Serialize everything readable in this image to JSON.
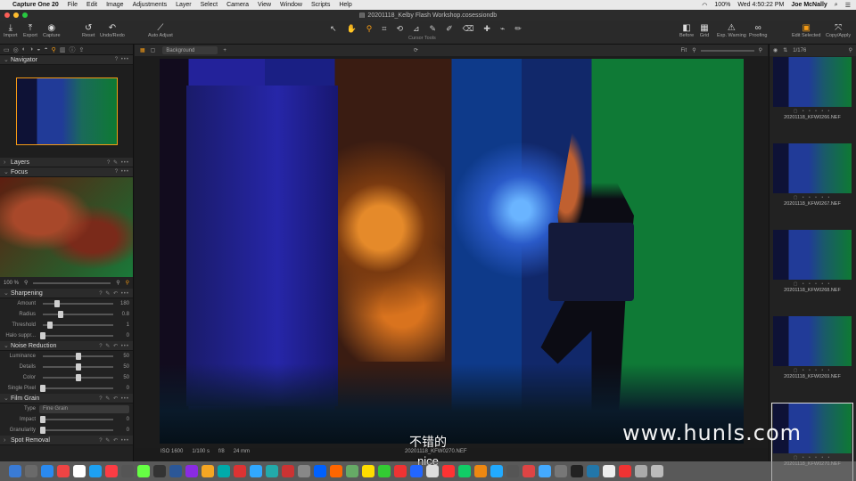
{
  "menubar": {
    "app": "Capture One 20",
    "items": [
      "File",
      "Edit",
      "Image",
      "Adjustments",
      "Layer",
      "Select",
      "Camera",
      "View",
      "Window",
      "Scripts",
      "Help"
    ],
    "battery": "100%",
    "clock": "Wed 4:50:22 PM",
    "user": "Joe McNally"
  },
  "window": {
    "title": "20201118_Kelby Flash Workshop.cosessiondb"
  },
  "toolbar": {
    "import": "Import",
    "export": "Export",
    "capture": "Capture",
    "reset": "Reset",
    "undo_redo": "Undo/Redo",
    "auto_adjust": "Auto Adjust",
    "cursor_tools": "Cursor Tools",
    "before": "Before",
    "grid": "Grid",
    "exp_warning": "Exp. Warning",
    "proofing": "Proofing",
    "edit_selected": "Edit Selected",
    "copy_apply": "Copy/Apply"
  },
  "left_panel": {
    "navigator": "Navigator",
    "layers": "Layers",
    "focus": "Focus",
    "focus_zoom": "100 %",
    "sharpening": {
      "title": "Sharpening",
      "rows": [
        {
          "label": "Amount",
          "value": "180",
          "pos": 0.2
        },
        {
          "label": "Radius",
          "value": "0.8",
          "pos": 0.25
        },
        {
          "label": "Threshold",
          "value": "1",
          "pos": 0.1
        },
        {
          "label": "Halo suppr...",
          "value": "0",
          "pos": 0.0
        }
      ]
    },
    "noise_reduction": {
      "title": "Noise Reduction",
      "rows": [
        {
          "label": "Luminance",
          "value": "50",
          "pos": 0.5
        },
        {
          "label": "Details",
          "value": "50",
          "pos": 0.5
        },
        {
          "label": "Color",
          "value": "50",
          "pos": 0.5
        },
        {
          "label": "Single Pixel",
          "value": "0",
          "pos": 0.0
        }
      ]
    },
    "film_grain": {
      "title": "Film Grain",
      "type_label": "Type",
      "type_value": "Fine Grain",
      "rows": [
        {
          "label": "Impact",
          "value": "0",
          "pos": 0.0
        },
        {
          "label": "Granularity",
          "value": "0",
          "pos": 0.0
        }
      ]
    },
    "spot_removal": "Spot Removal"
  },
  "viewer": {
    "layer": "Background",
    "fit": "Fit",
    "iso": "ISO 1600",
    "shutter": "1/100 s",
    "aperture": "f/8",
    "focal": "24 mm",
    "filename": "20201118_KFW0270.NEF"
  },
  "browser": {
    "count": "1/176",
    "thumbs": [
      {
        "name": "20201118_KFW0266.NEF"
      },
      {
        "name": "20201118_KFW0267.NEF"
      },
      {
        "name": "20201118_KFW0268.NEF"
      },
      {
        "name": "20201118_KFW0269.NEF"
      },
      {
        "name": "20201118_KFW0270.NEF"
      }
    ]
  },
  "subtitles": {
    "line1": "不错的",
    "line2": "nice"
  },
  "watermark": "www.hunls.com",
  "colors": {
    "accent": "#f59b14",
    "panel": "#222222",
    "toolbar": "#2a2a2a"
  }
}
